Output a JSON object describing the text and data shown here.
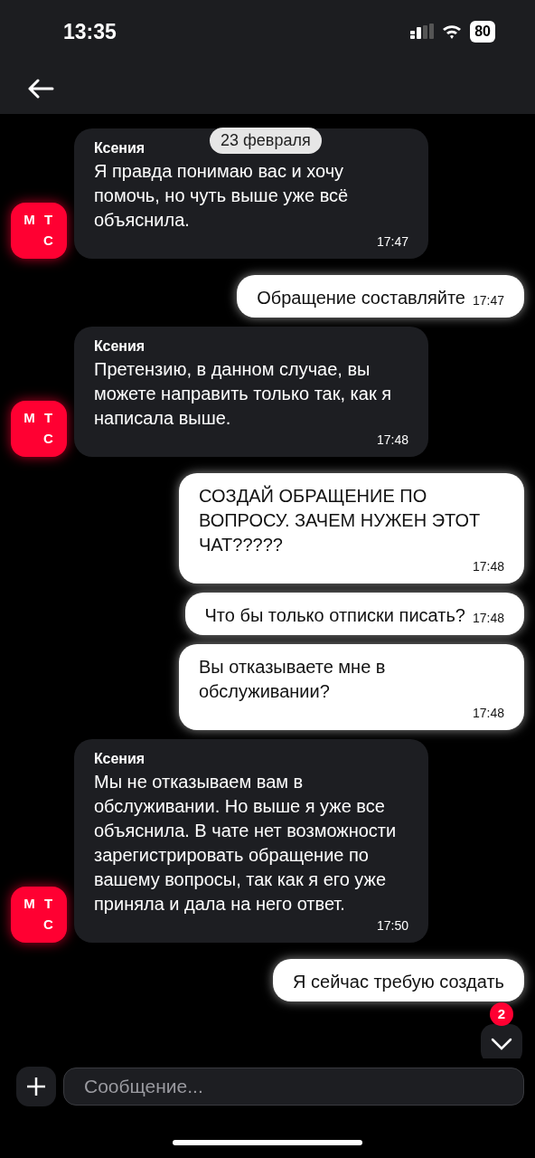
{
  "status_bar": {
    "time": "13:35",
    "battery": "80"
  },
  "date_chip": "23 февраля",
  "messages": [
    {
      "kind": "incoming",
      "sender": "Ксения",
      "text": "Я правда понимаю вас и хочу помочь, но чуть выше уже всё объяснила.",
      "time": "17:47",
      "avatar": [
        "М",
        "Т",
        "С"
      ]
    },
    {
      "kind": "outgoing",
      "text": "Обращение составляйте",
      "time": "17:47"
    },
    {
      "kind": "incoming",
      "sender": "Ксения",
      "text": "Претензию, в данном случае, вы можете направить только так, как я написала выше.",
      "time": "17:48",
      "avatar": [
        "М",
        "Т",
        "С"
      ]
    },
    {
      "kind": "outgoing",
      "text": "СОЗДАЙ ОБРАЩЕНИЕ ПО ВОПРОСУ. ЗАЧЕМ НУЖЕН ЭТОТ ЧАТ?????",
      "time": "17:48"
    },
    {
      "kind": "outgoing",
      "text": "Что бы только отписки писать?",
      "time": "17:48"
    },
    {
      "kind": "outgoing",
      "text": "Вы отказываете мне в обслуживании?",
      "time": "17:48"
    },
    {
      "kind": "incoming",
      "sender": "Ксения",
      "text": "Мы не отказываем вам в обслуживании. Но выше я уже все объяснила. В чате нет возможности зарегистрировать обращение по вашему вопросы, так как я его уже приняла и дала на него ответ.",
      "time": "17:50",
      "avatar": [
        "М",
        "Т",
        "С"
      ]
    },
    {
      "kind": "outgoing",
      "text": "Я сейчас требую создать"
    }
  ],
  "scroll_badge": "2",
  "composer": {
    "placeholder": "Сообщение..."
  }
}
